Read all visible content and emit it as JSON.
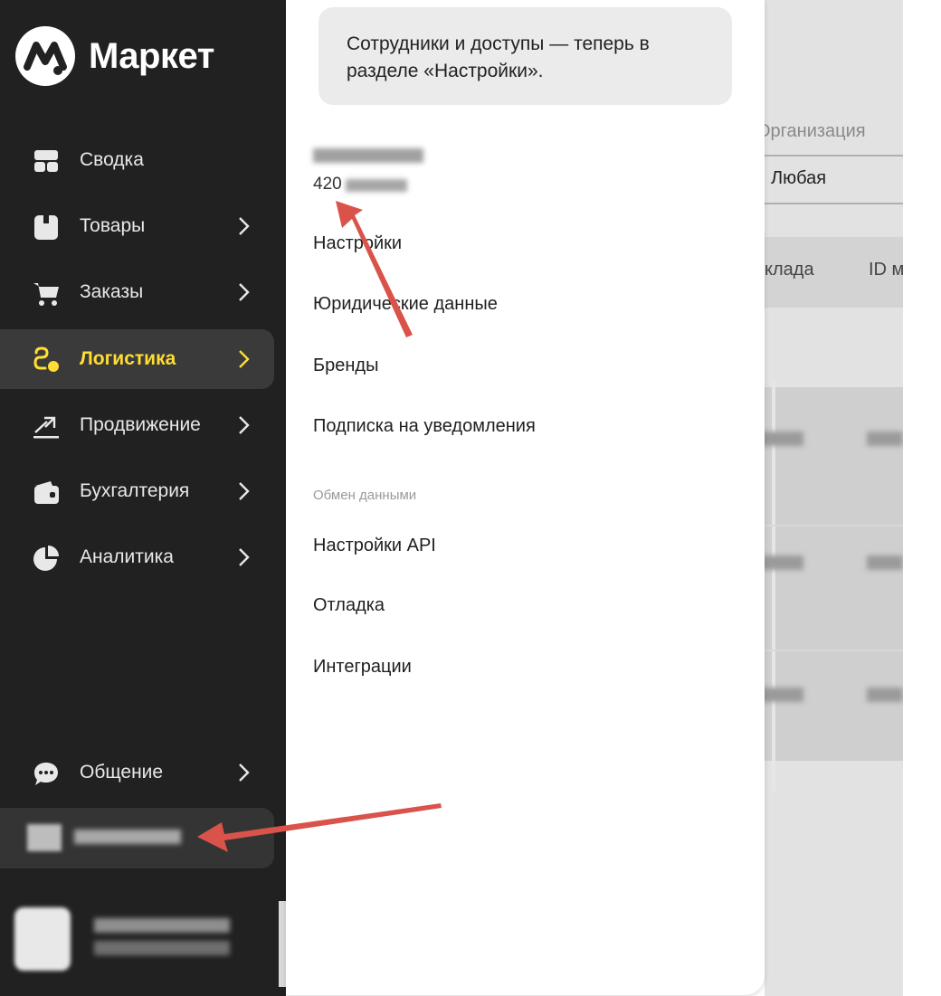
{
  "sidebar": {
    "logo_text": "Маркет",
    "nav": [
      {
        "label": "Сводка",
        "icon": "dashboard-icon"
      },
      {
        "label": "Товары",
        "icon": "box-icon"
      },
      {
        "label": "Заказы",
        "icon": "cart-icon"
      },
      {
        "label": "Логистика",
        "icon": "route-icon",
        "active": true
      },
      {
        "label": "Продвижение",
        "icon": "trend-icon"
      },
      {
        "label": "Бухгалтерия",
        "icon": "wallet-icon"
      },
      {
        "label": "Аналитика",
        "icon": "pie-chart-icon"
      }
    ],
    "chat": {
      "label": "Общение",
      "icon": "chat-bubble-icon"
    }
  },
  "panel": {
    "hint": "Сотрудники и доступы — теперь в разделе «Настройки».",
    "account_id_prefix": "420",
    "menu": [
      "Настройки",
      "Юридические данные",
      "Бренды",
      "Подписка на уведомления"
    ],
    "section_title": "Обмен данными",
    "section_menu": [
      "Настройки API",
      "Отладка",
      "Интеграции"
    ]
  },
  "background_page": {
    "filter_label": "Организация",
    "filter_value": "Любая",
    "columns": [
      "клада",
      "ID м"
    ]
  },
  "colors": {
    "sidebar_bg": "#212121",
    "active_accent": "#ffdd33",
    "annotation_arrow": "#d9534a"
  }
}
